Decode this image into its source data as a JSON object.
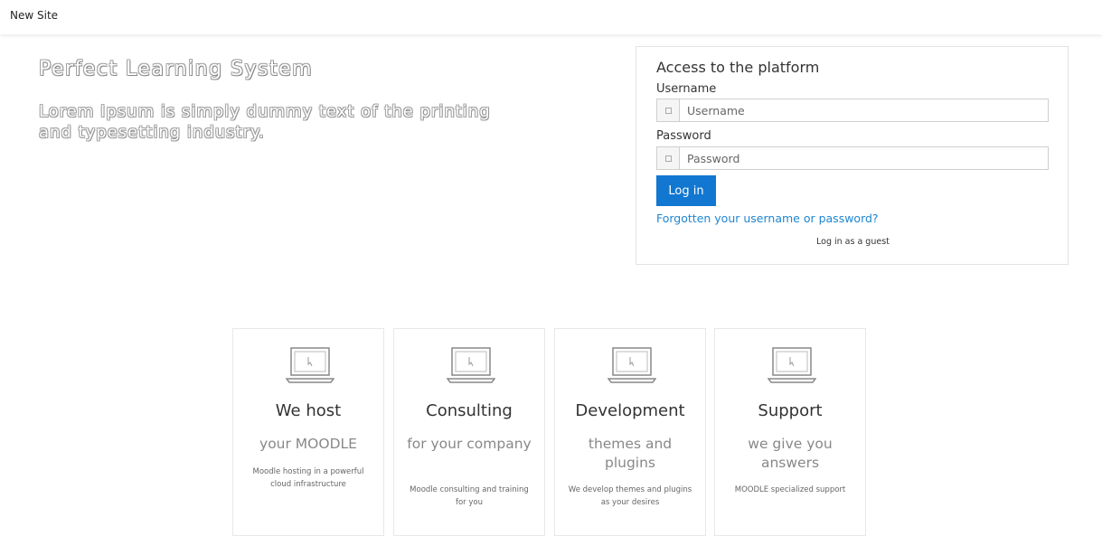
{
  "header": {
    "site_name": "New Site"
  },
  "hero": {
    "title": "Perfect Learning System",
    "subtitle": "Lorem Ipsum is simply dummy text of the printing and typesetting industry."
  },
  "login": {
    "title": "Access to the platform",
    "username_label": "Username",
    "username_placeholder": "Username",
    "password_label": "Password",
    "password_placeholder": "Password",
    "login_button": "Log in",
    "forgot_link": "Forgotten your username or password?",
    "guest_link": "Log in as a guest",
    "accent_color": "#1177d1"
  },
  "cards": [
    {
      "icon": "laptop-icon",
      "title": "We host",
      "subtitle": "your MOODLE",
      "description": "Moodle hosting in a powerful cloud infrastructure"
    },
    {
      "icon": "laptop-icon",
      "title": "Consulting",
      "subtitle": "for your company",
      "description": "Moodle consulting and training for you"
    },
    {
      "icon": "laptop-icon",
      "title": "Development",
      "subtitle": "themes and plugins",
      "description": "We develop themes and plugins as your desires"
    },
    {
      "icon": "laptop-icon",
      "title": "Support",
      "subtitle": "we give you answers",
      "description": "MOODLE specialized support"
    }
  ]
}
